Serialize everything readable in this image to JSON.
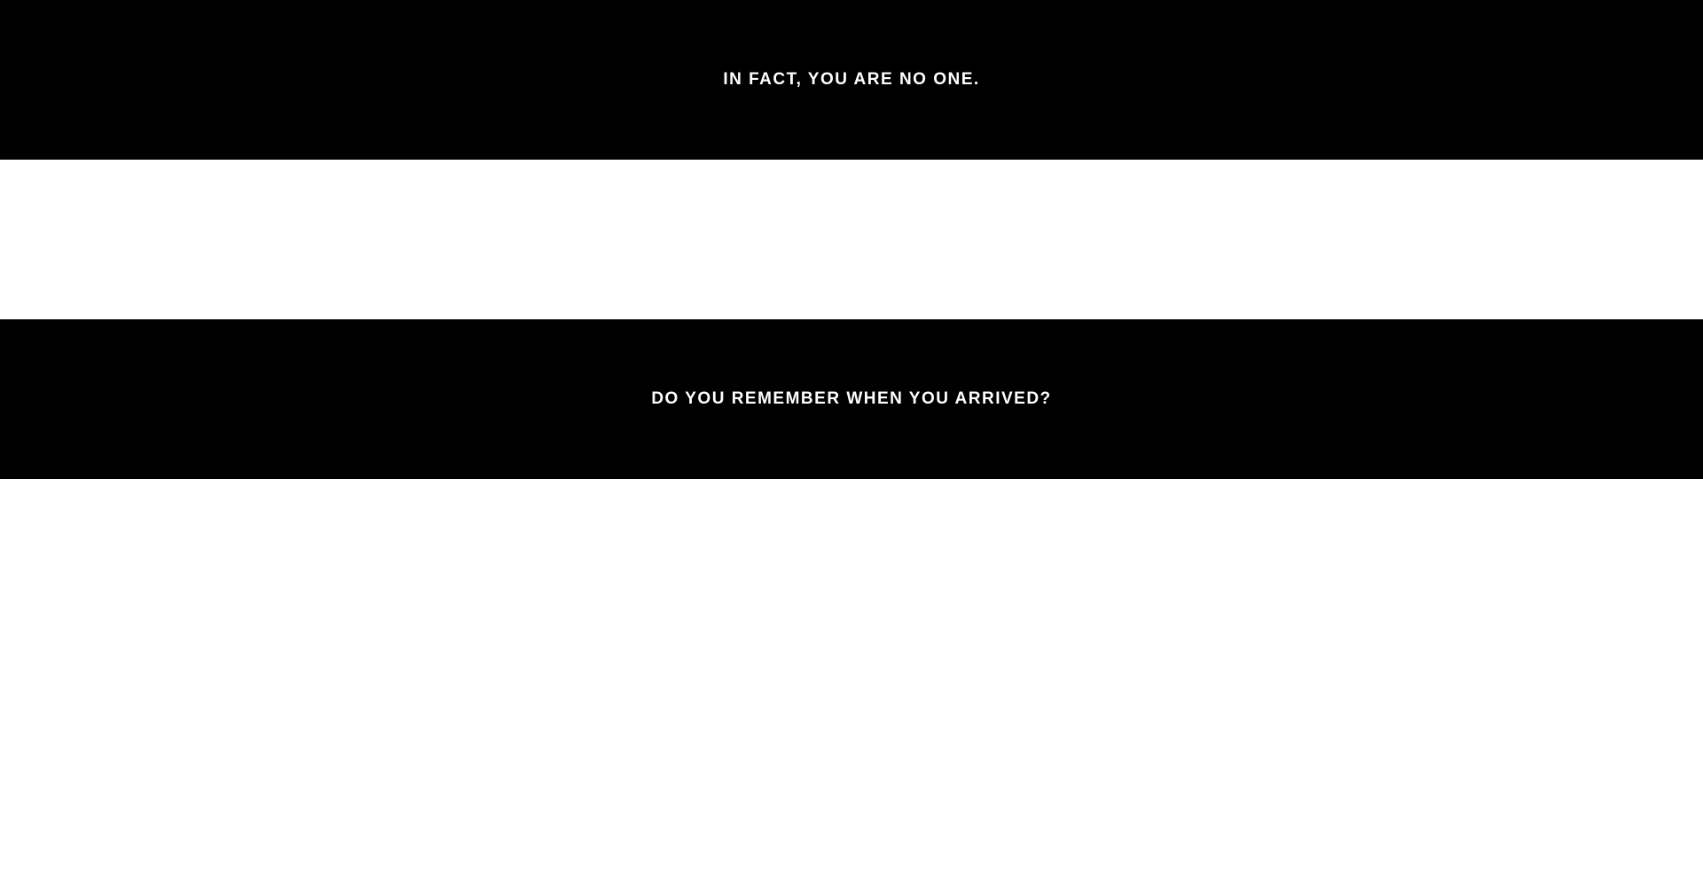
{
  "bands": [
    {
      "text": "IN FACT, YOU ARE NO ONE.",
      "background": "#000000",
      "color": "#ffffff"
    },
    {
      "text": "DO YOU REMEMBER WHEN YOU ARRIVED?",
      "background": "#000000",
      "color": "#ffffff"
    }
  ],
  "colors": {
    "page_background": "#ffffff",
    "band_background": "#000000",
    "band_text": "#ffffff"
  }
}
